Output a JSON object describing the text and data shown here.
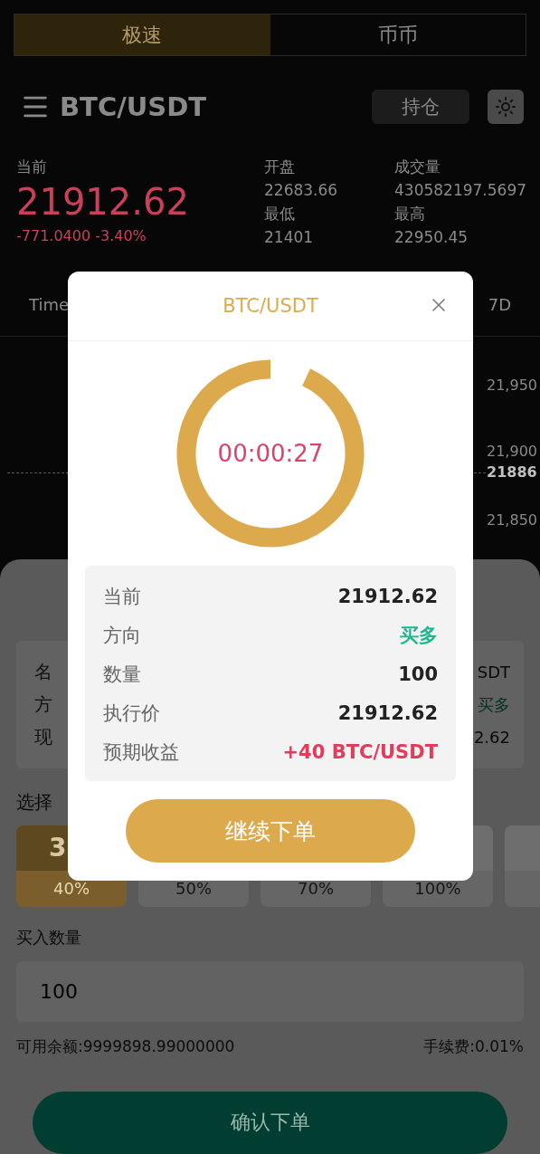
{
  "mode_tabs": [
    {
      "label": "极速",
      "selected": true
    },
    {
      "label": "币币",
      "selected": false
    }
  ],
  "header": {
    "pair": "BTC/USDT",
    "positions_button": "持仓"
  },
  "ticker": {
    "current_label": "当前",
    "price": "21912.62",
    "change": "-771.0400 -3.40%",
    "stats": [
      {
        "label": "开盘",
        "value": "22683.66"
      },
      {
        "label": "成交量",
        "value": "430582197.5697"
      },
      {
        "label": "最低",
        "value": "21401"
      },
      {
        "label": "最高",
        "value": "22950.45"
      }
    ]
  },
  "chart_tabs": [
    {
      "label": "Time"
    },
    {
      "label": "7D"
    }
  ],
  "chart_prices": [
    {
      "text": "21,950",
      "highlighted": false
    },
    {
      "text": "21,900",
      "highlighted": false
    },
    {
      "text": "21886",
      "highlighted": true
    },
    {
      "text": "21,850",
      "highlighted": false
    }
  ],
  "order": {
    "info": [
      {
        "label": "名",
        "value": "SDT",
        "kind": "plain"
      },
      {
        "label": "方",
        "value": "买多",
        "kind": "buy"
      },
      {
        "label": "现",
        "value": "2.62",
        "kind": "plain"
      }
    ],
    "duration_label": "选择",
    "durations": [
      {
        "time": "3",
        "rate": "40%",
        "selected": true
      },
      {
        "rate": "50%",
        "selected": false
      },
      {
        "rate": "70%",
        "selected": false
      },
      {
        "rate": "100%",
        "selected": false
      },
      {
        "selected": false
      }
    ],
    "quantity_label": "买入数量",
    "quantity_value": "100",
    "balance": "可用余额:9999898.99000000",
    "fee": "手续费:0.01%",
    "confirm_button": "确认下单"
  },
  "modal": {
    "title": "BTC/USDT",
    "countdown": {
      "time": "00:00:27"
    },
    "rows": [
      {
        "label": "当前",
        "value": "21912.62",
        "kind": "plain"
      },
      {
        "label": "方向",
        "value": "买多",
        "kind": "buy"
      },
      {
        "label": "数量",
        "value": "100",
        "kind": "plain"
      },
      {
        "label": "执行价",
        "value": "21912.62",
        "kind": "plain"
      },
      {
        "label": "预期收益",
        "value": "+40 BTC/USDT",
        "kind": "profit"
      }
    ],
    "continue_button": "继续下单"
  }
}
